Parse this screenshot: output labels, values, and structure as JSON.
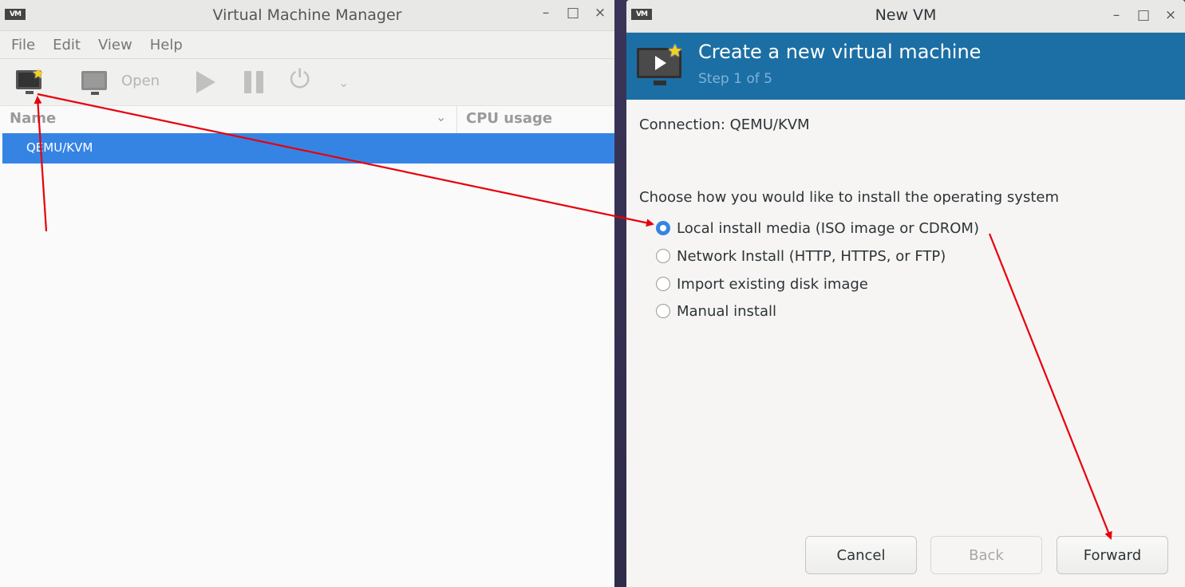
{
  "manager": {
    "title": "Virtual Machine Manager",
    "logo_text": "VM",
    "controls": [
      "–",
      "□",
      "×"
    ],
    "menu": [
      "File",
      "Edit",
      "View",
      "Help"
    ],
    "toolbar": {
      "new_icon": "new-vm-icon",
      "open_label": "Open",
      "run_icon": "play-icon",
      "pause_icon": "pause-icon",
      "shutdown_icon": "power-icon",
      "more_icon": "chevron-down-icon"
    },
    "columns": {
      "name": "Name",
      "cpu": "CPU usage"
    },
    "rows": [
      {
        "name": "QEMU/KVM",
        "selected": true
      }
    ]
  },
  "new_vm": {
    "title": "New VM",
    "logo_text": "VM",
    "controls": [
      "–",
      "□",
      "×"
    ],
    "header": {
      "title": "Create a new virtual machine",
      "step": "Step 1 of 5"
    },
    "connection_label": "Connection: QEMU/KVM",
    "prompt": "Choose how you would like to install the operating system",
    "options": [
      {
        "label": "Local install media (ISO image or CDROM)",
        "selected": true
      },
      {
        "label": "Network Install (HTTP, HTTPS, or FTP)",
        "selected": false
      },
      {
        "label": "Import existing disk image",
        "selected": false
      },
      {
        "label": "Manual install",
        "selected": false
      }
    ],
    "buttons": {
      "cancel": "Cancel",
      "back": "Back",
      "forward": "Forward"
    }
  },
  "colors": {
    "selection": "#3584e4",
    "banner": "#1c6fa4",
    "annotation_arrow": "#e8000b"
  }
}
